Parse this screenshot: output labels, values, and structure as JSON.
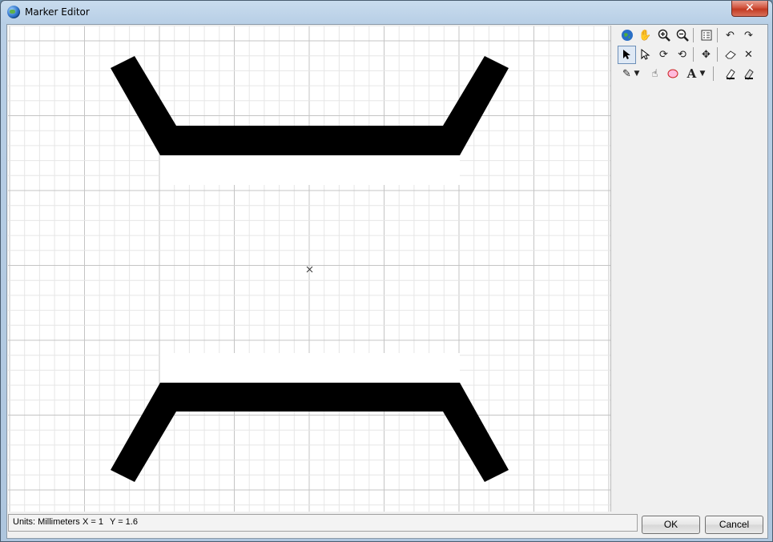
{
  "window": {
    "title": "Marker Editor",
    "close_glyph": "✕"
  },
  "statusbar": {
    "units": "Units: Millimeters",
    "x": "X = 1",
    "y": "Y = 1.6"
  },
  "buttons": {
    "ok": "OK",
    "cancel": "Cancel"
  },
  "toolbar": {
    "rows": [
      [
        "globe-icon",
        "hand-pan-icon",
        "zoom-in-icon",
        "zoom-out-icon",
        "properties-icon",
        "undo-icon",
        "redo-icon"
      ],
      [
        "select-arrow-icon",
        "select-vertex-icon",
        "rotate-icon",
        "rotate-alt-icon",
        "move-icon",
        "eraser-icon",
        "delete-x-icon"
      ],
      [
        "draw-point-icon",
        "dropdown-arrow-icon",
        "draw-freehand-icon",
        "draw-ellipse-icon",
        "text-icon",
        "dropdown-arrow-icon",
        "fill-color-icon",
        "line-color-icon"
      ]
    ],
    "text_tool_glyph": "A"
  },
  "colors": {
    "marker": "#000000",
    "grid_minor": "#e6e6e6",
    "grid_major": "#c4c4c4"
  }
}
